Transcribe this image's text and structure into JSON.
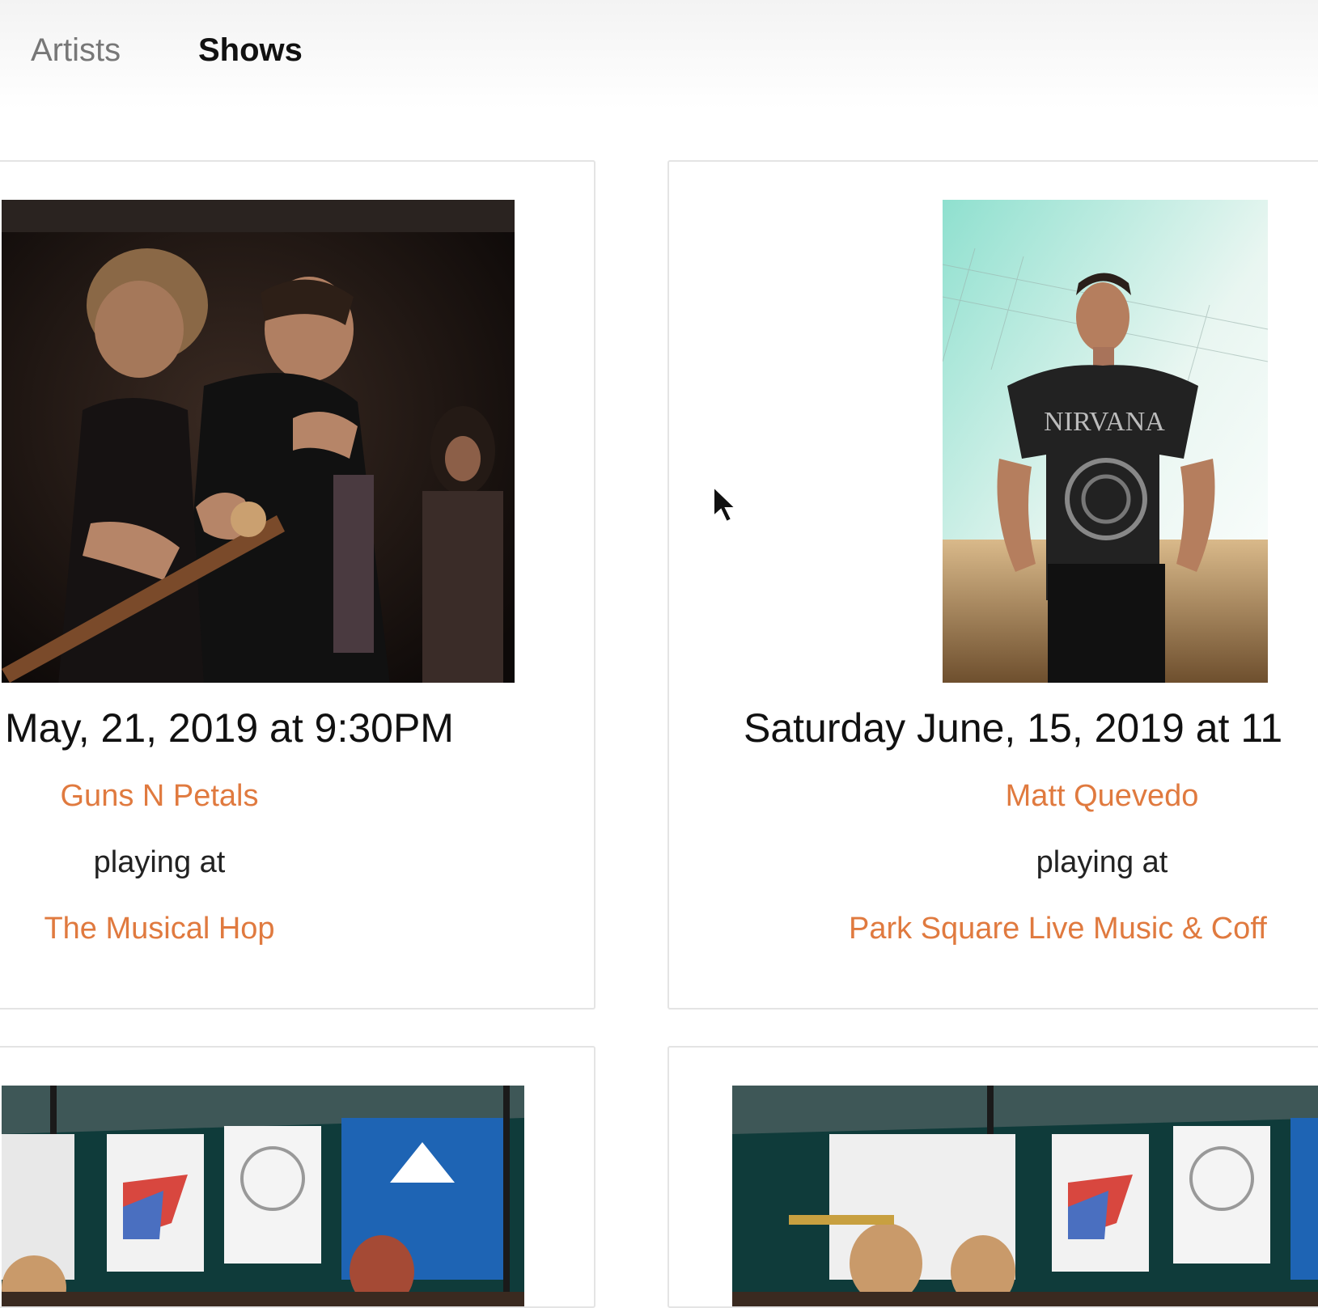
{
  "nav": {
    "artists_label": "Artists",
    "shows_label": "Shows"
  },
  "shows": [
    {
      "date": "May, 21, 2019 at 9:30PM",
      "artist": "Guns N Petals",
      "playing_label": "playing at",
      "venue": "The Musical Hop"
    },
    {
      "date": "Saturday June, 15, 2019 at 11",
      "artist": "Matt Quevedo",
      "playing_label": "playing at",
      "venue": "Park Square Live Music & Coff",
      "shirt_text": "NIRVANA"
    }
  ],
  "colors": {
    "accent": "#e07a3f",
    "text": "#111111",
    "nav_muted": "#777777",
    "card_border": "#e4e4e4"
  }
}
